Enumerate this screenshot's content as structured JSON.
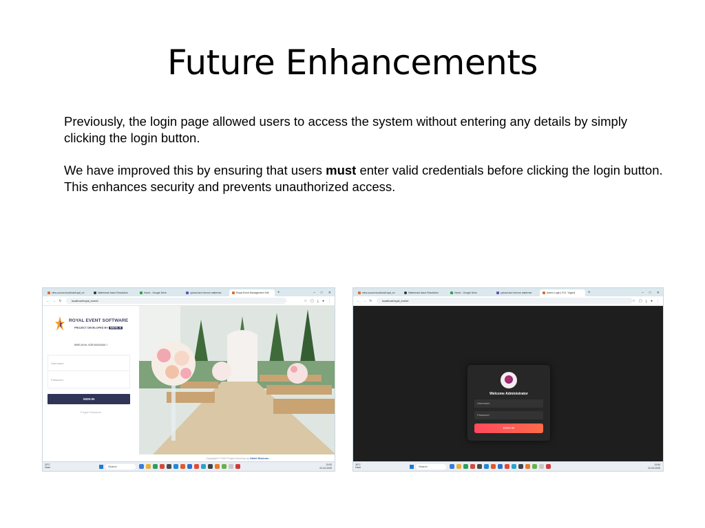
{
  "slide": {
    "title": "Future Enhancements",
    "para1": "Previously, the login page allowed users to access the system without entering any details by simply clicking the login button.",
    "para2_before": "We have improved this by ensuring that users ",
    "para2_bold": "must",
    "para2_after": " enter valid credentials before clicking the login button. This enhances security and prevents unauthorized access."
  },
  "left_screenshot": {
    "tabs": [
      "view-source:localhost/royal_ev",
      "Watermark Issue Resolution",
      "Home - Google Drive",
      "upload and remove watermar",
      "Royal Event Management Soft"
    ],
    "address": "localhost/royal_event/",
    "brand": "ROYAL EVENT SOFTWARE",
    "dev_prefix": "PROJECT DEVELOPED BY",
    "dev_name": "NIKHIL B",
    "welcome": "Welcome Administrator !",
    "username_placeholder": "Username",
    "password_placeholder": "Password",
    "signin": "SIGN IN",
    "forgot": "Forgot Password",
    "copyright_prefix": "Copyright © 2022 Project Develop by ",
    "copyright_name": "Nikhil Bhalerao",
    "weather": "30°C\nHaze",
    "search": "Search",
    "tray": "13:53\n22-03-2025"
  },
  "right_screenshot": {
    "tabs": [
      "view-source:localhost/royal_ev",
      "Watermark Issue Resolution",
      "Home - Google Drive",
      "upload and remove watermar",
      "Admin Login | R.E. Togami"
    ],
    "address": "localhost/royal_event/",
    "welcome": "Welcome Administrator",
    "username_placeholder": "Username",
    "password_placeholder": "Password",
    "signin": "SIGN IN",
    "weather": "30°C\nHaze",
    "search": "Search",
    "tray": "13:54\n22-03-2025"
  },
  "colors": {
    "left_signin_button": "#303456",
    "right_signin_button": "#ff4a5c",
    "right_background": "#1e1e1e"
  }
}
